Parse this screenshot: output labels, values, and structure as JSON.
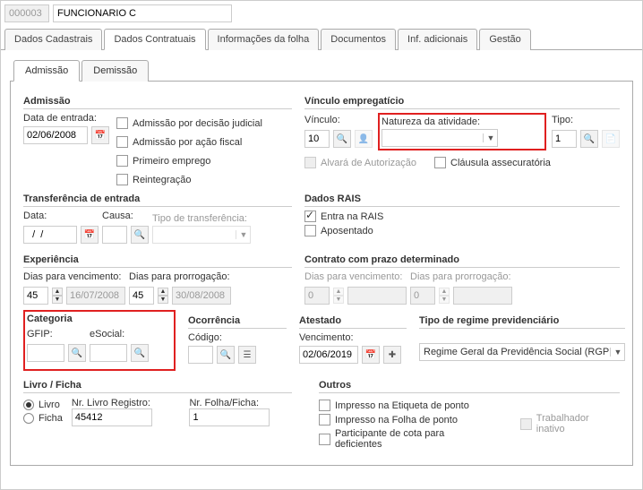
{
  "header": {
    "id_value": "000003",
    "name_value": "FUNCIONARIO C"
  },
  "main_tabs": [
    "Dados Cadastrais",
    "Dados Contratuais",
    "Informações da folha",
    "Documentos",
    "Inf. adicionais",
    "Gestão"
  ],
  "sub_tabs": [
    "Admissão",
    "Demissão"
  ],
  "admissao": {
    "title": "Admissão",
    "data_entrada_lbl": "Data de entrada:",
    "data_entrada_val": "02/06/2008",
    "chk_judicial": "Admissão por decisão judicial",
    "chk_fiscal": "Admissão por ação fiscal",
    "chk_primeiro": "Primeiro emprego",
    "chk_reint": "Reintegração"
  },
  "vinculo": {
    "title": "Vínculo empregatício",
    "vinculo_lbl": "Vínculo:",
    "vinculo_val": "10",
    "natureza_lbl": "Natureza da atividade:",
    "natureza_val": "",
    "tipo_lbl": "Tipo:",
    "tipo_val": "1",
    "chk_alvara": "Alvará de Autorização",
    "chk_clausula": "Cláusula assecuratória"
  },
  "trans": {
    "title": "Transferência de entrada",
    "data_lbl": "Data:",
    "data_val": "  /  /    ",
    "causa_lbl": "Causa:",
    "causa_val": "",
    "tipo_lbl": "Tipo de transferência:"
  },
  "rais": {
    "title": "Dados RAIS",
    "chk_entra": "Entra na RAIS",
    "chk_apos": "Aposentado"
  },
  "exp": {
    "title": "Experiência",
    "venc_lbl": "Dias para vencimento:",
    "venc_val": "45",
    "venc_date": "16/07/2008",
    "prorr_lbl": "Dias para prorrogação:",
    "prorr_val": "45",
    "prorr_date": "30/08/2008"
  },
  "contrato": {
    "title": "Contrato com prazo determinado",
    "venc_lbl": "Dias para vencimento:",
    "venc_val": "0",
    "prorr_lbl": "Dias para prorrogação:",
    "prorr_val": "0"
  },
  "categoria": {
    "title": "Categoria",
    "gfip_lbl": "GFIP:",
    "gfip_val": "",
    "esocial_lbl": "eSocial:",
    "esocial_val": ""
  },
  "ocorr": {
    "title": "Ocorrência",
    "codigo_lbl": "Código:",
    "codigo_val": ""
  },
  "atest": {
    "title": "Atestado",
    "venc_lbl": "Vencimento:",
    "venc_val": "02/06/2019"
  },
  "regime": {
    "title": "Tipo de regime previdenciário",
    "val": "Regime Geral da Previdência Social (RGP"
  },
  "livro": {
    "title": "Livro / Ficha",
    "radio_livro": "Livro",
    "radio_ficha": "Ficha",
    "nr_reg_lbl": "Nr. Livro Registro:",
    "nr_reg_val": "45412",
    "nr_folha_lbl": "Nr. Folha/Ficha:",
    "nr_folha_val": "1"
  },
  "outros": {
    "title": "Outros",
    "chk_etiqueta": "Impresso na Etiqueta de ponto",
    "chk_folha": "Impresso na Folha de ponto",
    "chk_cota": "Participante de cota para deficientes",
    "chk_inativo": "Trabalhador inativo"
  }
}
